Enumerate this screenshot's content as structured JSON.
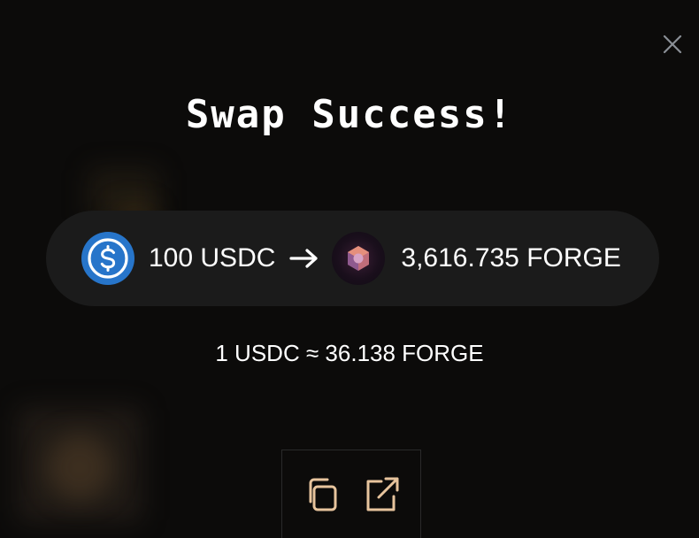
{
  "modal": {
    "title": "Swap Success!",
    "close_icon": "close-icon"
  },
  "swap": {
    "from_amount": "100 USDC",
    "from_token_icon": "usdc-icon",
    "arrow_icon": "arrow-right-icon",
    "to_token_icon": "forge-icon",
    "to_amount": "3,616.735 FORGE"
  },
  "rate_text": "1 USDC ≈ 36.138 FORGE",
  "actions": {
    "copy_icon": "copy-icon",
    "external_link_icon": "external-link-icon"
  },
  "colors": {
    "background": "#0c0b0a",
    "pill": "#1b1b1b",
    "usdc_blue": "#2775ca",
    "action_accent": "#e7c49d",
    "close_gray": "#8a8f96"
  }
}
